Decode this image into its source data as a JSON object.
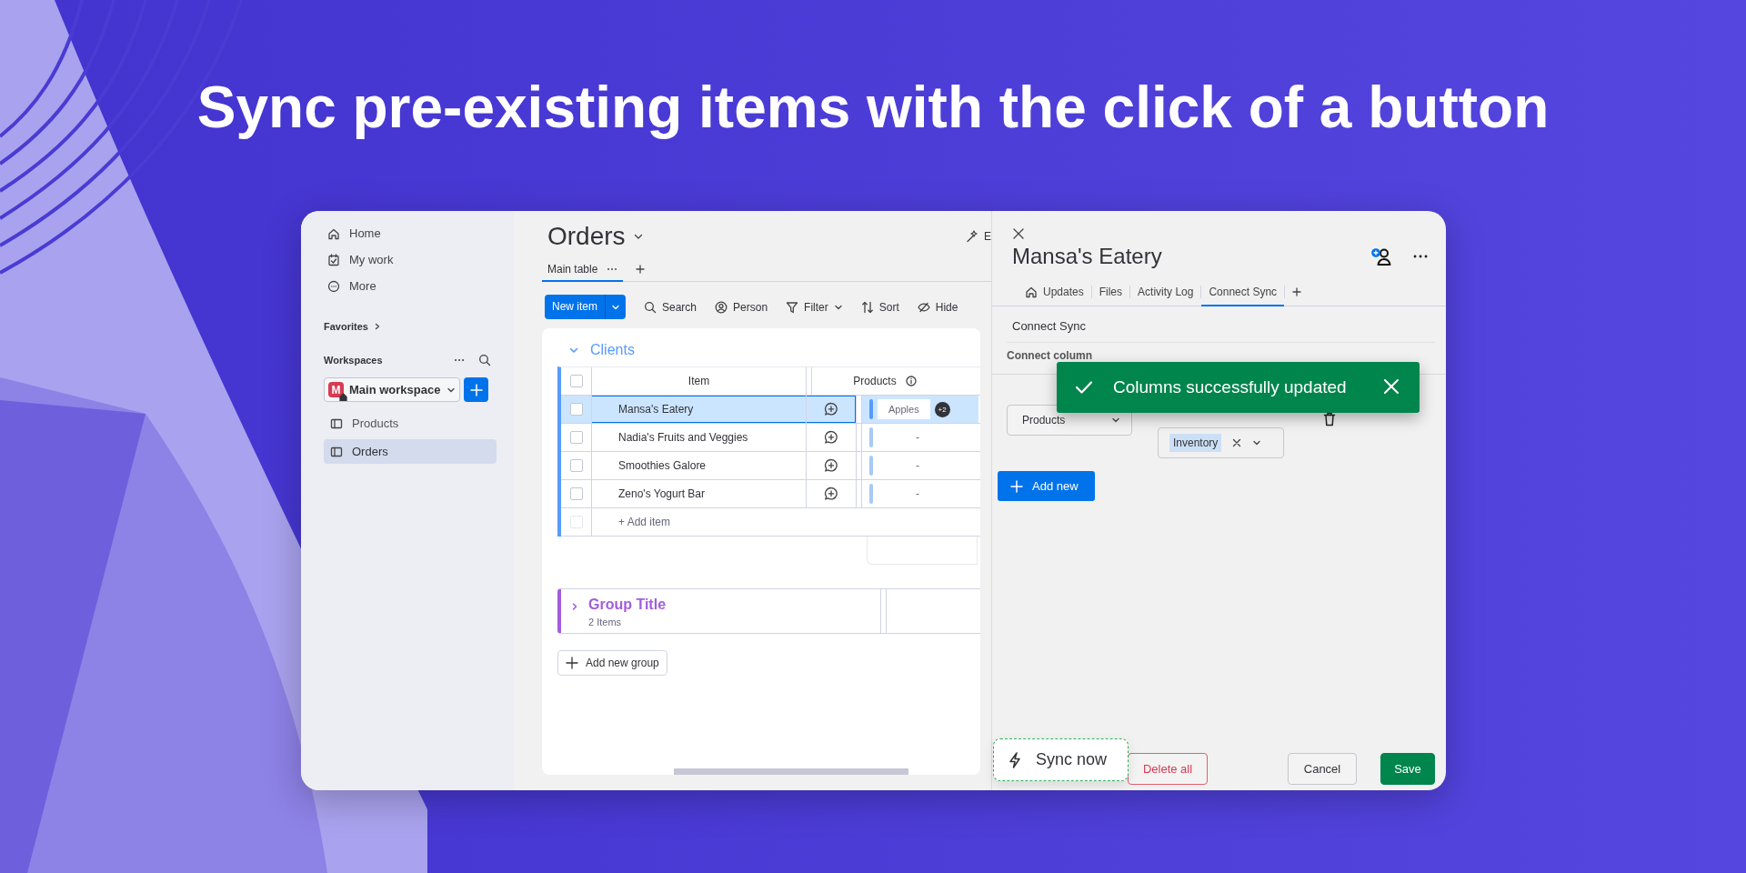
{
  "headline": "Sync pre-existing items with the click of a button",
  "sidebar": {
    "nav": [
      {
        "label": "Home",
        "kind": "home"
      },
      {
        "label": "My work",
        "kind": "mywork"
      },
      {
        "label": "More",
        "kind": "more"
      }
    ],
    "favorites": "Favorites",
    "workspaces_label": "Workspaces",
    "workspace": {
      "initial": "M",
      "name": "Main workspace"
    },
    "boards": [
      {
        "label": "Products",
        "selected": false
      },
      {
        "label": "Orders",
        "selected": true
      }
    ]
  },
  "board": {
    "title": "Orders",
    "header_cut": "E",
    "view_tabs": [
      {
        "label": "Main table",
        "selected": true
      }
    ],
    "new_item": "New item",
    "actions": [
      {
        "label": "Search",
        "kind": "search"
      },
      {
        "label": "Person",
        "kind": "person"
      },
      {
        "label": "Filter",
        "kind": "filter"
      },
      {
        "label": "Sort",
        "kind": "sort"
      },
      {
        "label": "Hide",
        "kind": "hide"
      }
    ],
    "groups": [
      {
        "title": "Clients",
        "expanded": true,
        "color": "#579bfc",
        "columns": [
          "Item",
          "Products"
        ],
        "select_all_checked": false,
        "add_item_disabled": true,
        "rows": [
          {
            "name": "Mansa's Eatery",
            "selected": true,
            "checked": false,
            "products": "Apples",
            "more": "+2"
          },
          {
            "name": "Nadia's Fruits and Veggies",
            "selected": false,
            "checked": false,
            "products": "-"
          },
          {
            "name": "Smoothies Galore",
            "selected": false,
            "checked": false,
            "products": "-"
          },
          {
            "name": "Zeno's Yogurt Bar",
            "selected": false,
            "checked": false,
            "products": "-"
          }
        ],
        "add_item": "+ Add item"
      },
      {
        "title": "Group Title",
        "expanded": false,
        "color": "#a25ddc",
        "count": "2 Items"
      }
    ],
    "add_group": "Add new group"
  },
  "panel": {
    "title": "Mansa's Eatery",
    "tabs": [
      {
        "label": "Updates",
        "kind": "home",
        "selected": false
      },
      {
        "label": "Files",
        "selected": false
      },
      {
        "label": "Activity Log",
        "selected": false
      },
      {
        "label": "Connect Sync",
        "selected": true
      }
    ],
    "section": "Connect Sync",
    "column_header": "Connect column",
    "source": "Products",
    "targets": [
      "Inventory"
    ],
    "add_new": "Add new",
    "toast": "Columns successfully updated",
    "sync_now": "Sync now",
    "delete_all": "Delete all",
    "cancel": "Cancel",
    "save": "Save"
  }
}
